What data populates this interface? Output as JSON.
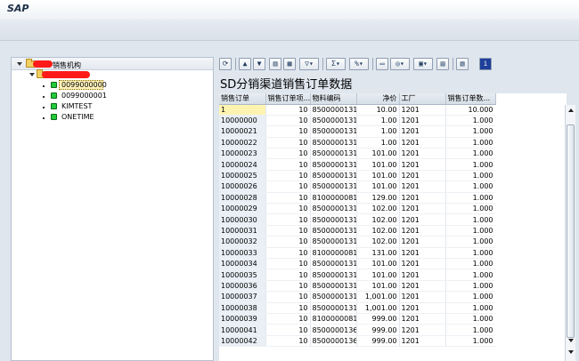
{
  "window": {
    "title": "SAP"
  },
  "tree": {
    "root_label": "销售机构",
    "items": [
      "0099000000",
      "0099000001",
      "KIMTEST",
      "ONETIME"
    ]
  },
  "toolbar": {
    "icons": [
      "refresh-icon",
      "sort-asc-icon",
      "filter-icon",
      "find-icon",
      "find-next-icon",
      "filter-menu-icon",
      "sum-icon",
      "subtotal-icon",
      "print-icon",
      "view-icon",
      "export-icon",
      "layout-grid-icon",
      "select-layout-icon",
      "info-icon"
    ]
  },
  "grid": {
    "title": "SD分销渠道销售订单数据",
    "headers": [
      "销售订单",
      "销售订单项...",
      "物料编码",
      "净价",
      "工厂",
      "销售订单数..."
    ],
    "rows": [
      [
        "1",
        "10",
        "8500000131",
        "10.00",
        "1201",
        "10.000"
      ],
      [
        "10000000",
        "10",
        "8500000131",
        "1.00",
        "1201",
        "1.000"
      ],
      [
        "10000021",
        "10",
        "8500000131",
        "1.00",
        "1201",
        "1.000"
      ],
      [
        "10000022",
        "10",
        "8500000131",
        "1.00",
        "1201",
        "1.000"
      ],
      [
        "10000023",
        "10",
        "8500000131",
        "101.00",
        "1201",
        "1.000"
      ],
      [
        "10000024",
        "10",
        "8500000131",
        "101.00",
        "1201",
        "1.000"
      ],
      [
        "10000025",
        "10",
        "8500000131",
        "101.00",
        "1201",
        "1.000"
      ],
      [
        "10000026",
        "10",
        "8500000131",
        "101.00",
        "1201",
        "1.000"
      ],
      [
        "10000028",
        "10",
        "8100000081",
        "129.00",
        "1201",
        "1.000"
      ],
      [
        "10000029",
        "10",
        "8500000131",
        "102.00",
        "1201",
        "1.000"
      ],
      [
        "10000030",
        "10",
        "8500000131",
        "102.00",
        "1201",
        "1.000"
      ],
      [
        "10000031",
        "10",
        "8500000131",
        "102.00",
        "1201",
        "1.000"
      ],
      [
        "10000032",
        "10",
        "8500000131",
        "102.00",
        "1201",
        "1.000"
      ],
      [
        "10000033",
        "10",
        "8100000081",
        "131.00",
        "1201",
        "1.000"
      ],
      [
        "10000034",
        "10",
        "8500000131",
        "101.00",
        "1201",
        "1.000"
      ],
      [
        "10000035",
        "10",
        "8500000131",
        "101.00",
        "1201",
        "1.000"
      ],
      [
        "10000036",
        "10",
        "8500000131",
        "101.00",
        "1201",
        "1.000"
      ],
      [
        "10000037",
        "10",
        "8500000131",
        "1,001.00",
        "1201",
        "1.000"
      ],
      [
        "10000038",
        "10",
        "8500000131",
        "1,001.00",
        "1201",
        "1.000"
      ],
      [
        "10000039",
        "10",
        "8100000081",
        "999.00",
        "1201",
        "1.000"
      ],
      [
        "10000041",
        "10",
        "8500000136",
        "999.00",
        "1201",
        "1.000"
      ],
      [
        "10000042",
        "10",
        "8500000136",
        "999.00",
        "1201",
        "1.000"
      ]
    ]
  }
}
